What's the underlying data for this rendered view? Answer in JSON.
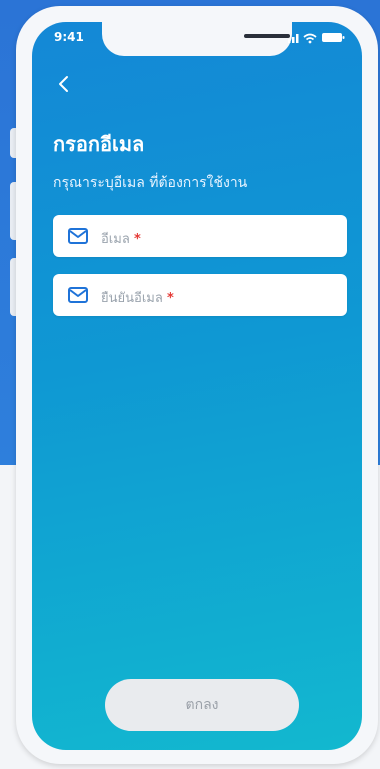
{
  "status": {
    "time": "9:41"
  },
  "header": {
    "title": "กรอกอีเมล",
    "subtitle": "กรุณาระบุอีเมล ที่ต้องการใช้งาน"
  },
  "form": {
    "email": {
      "placeholder": "อีเมล",
      "required_mark": "*"
    },
    "confirm_email": {
      "placeholder": "ยืนยันอีเมล",
      "required_mark": "*"
    }
  },
  "actions": {
    "submit_label": "ตกลง"
  },
  "colors": {
    "background_blue": "#2b74d6",
    "screen_gradient_start": "#1488d6",
    "screen_gradient_end": "#12b8cf",
    "icon_blue": "#1f73d8",
    "required_red": "#e53935"
  },
  "icons": {
    "back": "chevron-left-icon",
    "field": "mail-icon"
  }
}
